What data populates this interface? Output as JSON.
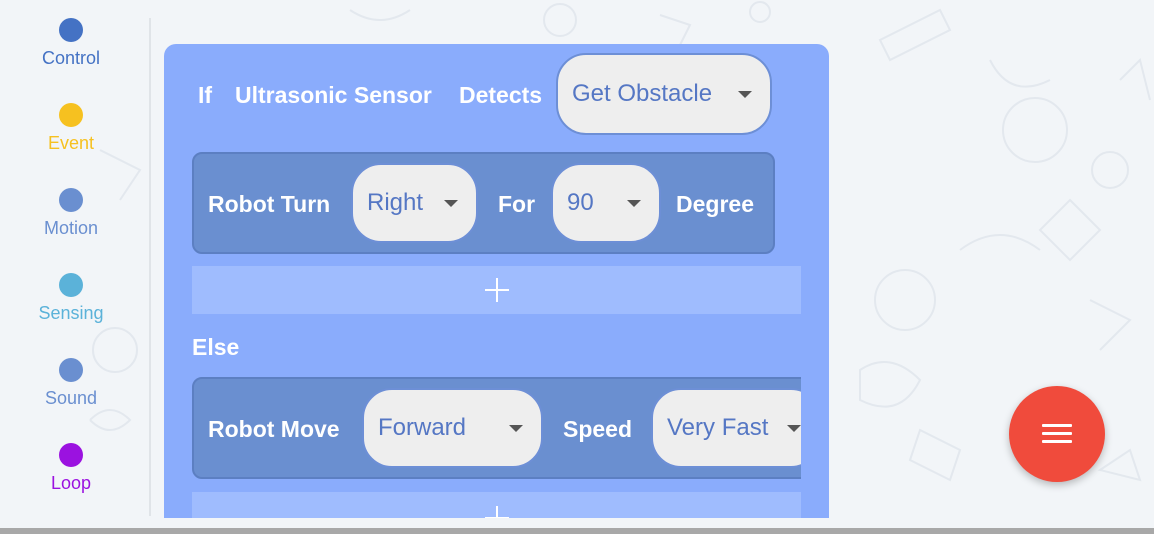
{
  "sidebar": {
    "items": [
      {
        "label": "Control",
        "color": "#4472c4"
      },
      {
        "label": "Event",
        "color": "#f6c120"
      },
      {
        "label": "Motion",
        "color": "#6a8fd0"
      },
      {
        "label": "Sensing",
        "color": "#5bb2d9"
      },
      {
        "label": "Sound",
        "color": "#6a8fd0"
      },
      {
        "label": "Loop",
        "color": "#9b12e0"
      }
    ]
  },
  "if_block": {
    "if_label": "If",
    "sensor_label": "Ultrasonic Sensor",
    "detects_label": "Detects",
    "condition_value": "Get Obstacle"
  },
  "turn_stmt": {
    "label": "Robot Turn",
    "direction_value": "Right",
    "for_label": "For",
    "angle_value": "90",
    "unit_label": "Degree"
  },
  "else_label": "Else",
  "move_stmt": {
    "label": "Robot Move",
    "direction_value": "Forward",
    "speed_label": "Speed",
    "speed_value": "Very Fast"
  },
  "fab": {
    "icon": "menu-icon",
    "color": "#f04b3c"
  },
  "icons": {
    "add": "plus-icon",
    "dropdown": "caret-down-icon"
  }
}
